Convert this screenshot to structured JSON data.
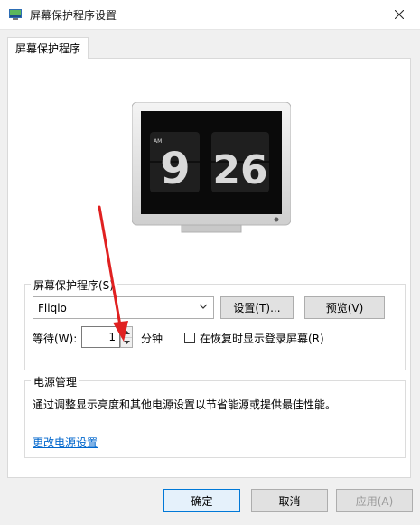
{
  "window": {
    "title": "屏幕保护程序设置"
  },
  "tab": {
    "label": "屏幕保护程序"
  },
  "preview": {
    "ampm": "AM",
    "hour": "9",
    "minute": "26"
  },
  "screensaver": {
    "legend": "屏幕保护程序(S)",
    "selected": "Fliqlo",
    "settings_label": "设置(T)...",
    "preview_label": "预览(V)",
    "wait_label": "等待(W):",
    "wait_value": "1",
    "wait_unit": "分钟",
    "resume_checkbox_label": "在恢复时显示登录屏幕(R)",
    "resume_checked": false
  },
  "power": {
    "legend": "电源管理",
    "description": "通过调整显示亮度和其他电源设置以节省能源或提供最佳性能。",
    "link": "更改电源设置"
  },
  "buttons": {
    "ok": "确定",
    "cancel": "取消",
    "apply": "应用(A)"
  },
  "colors": {
    "accent": "#0078d7",
    "link": "#0066cc",
    "arrow": "#e02020"
  }
}
